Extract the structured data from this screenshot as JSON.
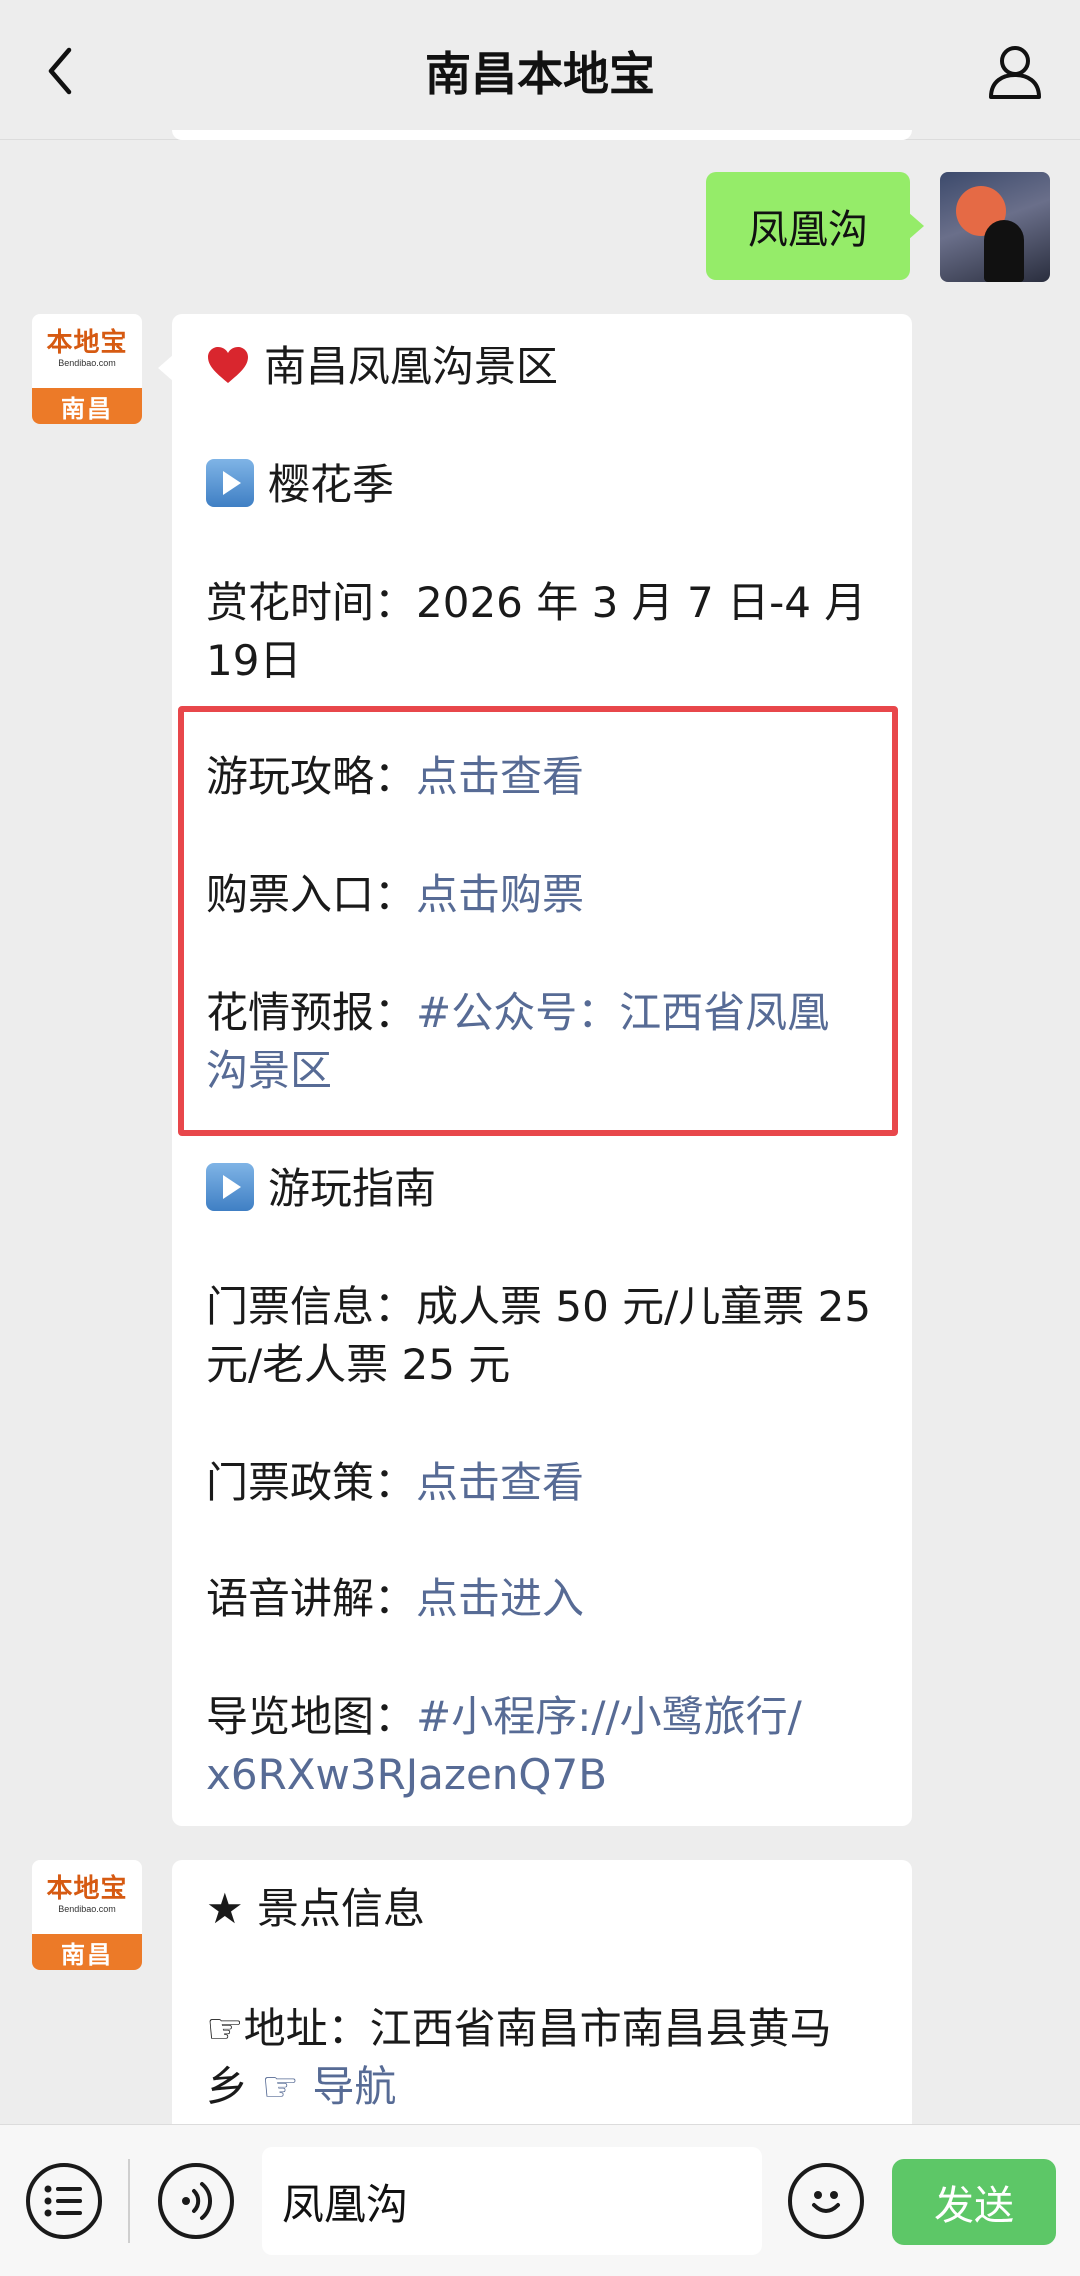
{
  "header": {
    "title": "南昌本地宝"
  },
  "brand_avatar": {
    "name": "本地宝",
    "site": "Bendibao.com",
    "city": "南昌"
  },
  "user_message": {
    "text": "凤凰沟"
  },
  "card1": {
    "heading": "南昌凤凰沟景区",
    "section1": "樱花季",
    "bloom_time_line1": "赏花时间：2026 年 3 月 7 日-4 月",
    "bloom_time_line2": "19日",
    "guide_label": "游玩攻略：",
    "guide_link": "点击查看",
    "ticket_label": "购票入口：",
    "ticket_link": "点击购票",
    "forecast_label": "花情预报：",
    "forecast_link_line1": "#公众号：江西省凤凰",
    "forecast_link_line2": "沟景区",
    "section2": "游玩指南",
    "ticket_info_line1": "门票信息：成人票 50 元/儿童票 25",
    "ticket_info_line2": "元/老人票 25 元",
    "policy_label": "门票政策：",
    "policy_link": "点击查看",
    "audio_label": "语音讲解：",
    "audio_link": "点击进入",
    "map_label": "导览地图：",
    "map_link_line1": "#小程序://小鹭旅行/",
    "map_link_line2": "x6RXw3RJazenQ7B"
  },
  "card2": {
    "heading": "★ 景点信息",
    "address_line1": "☞地址：江西省南昌市南昌县黄马",
    "address_line2": "乡",
    "nav_link": "☞ 导航"
  },
  "input_bar": {
    "input_value": "凤凰沟",
    "send_label": "发送"
  }
}
